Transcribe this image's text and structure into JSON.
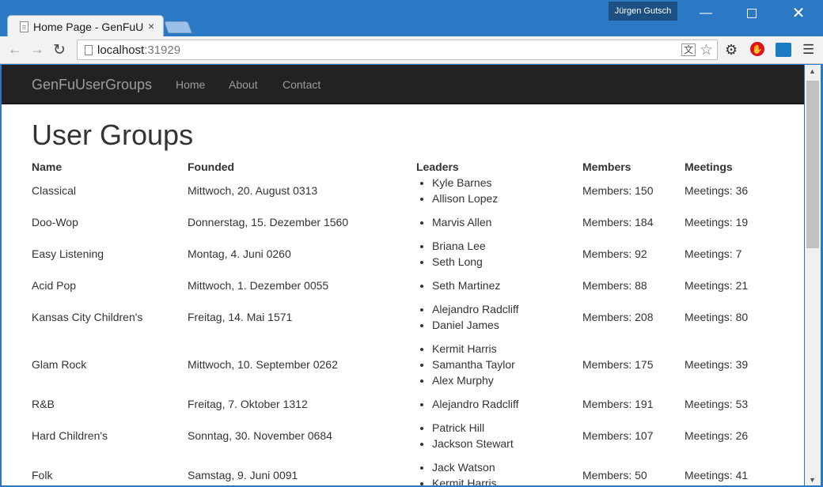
{
  "browser": {
    "tab_title": "Home Page - GenFuUserGroups",
    "tab_close": "×",
    "profile_name": "Jürgen Gutsch",
    "url_host": "localhost",
    "url_port": ":31929"
  },
  "navbar": {
    "brand": "GenFuUserGroups",
    "links": [
      "Home",
      "About",
      "Contact"
    ]
  },
  "page": {
    "title": "User Groups",
    "columns": [
      "Name",
      "Founded",
      "Leaders",
      "Members",
      "Meetings"
    ]
  },
  "rows": [
    {
      "name": "Classical",
      "founded": "Mittwoch, 20. August 0313",
      "leaders": [
        "Kyle Barnes",
        "Allison Lopez"
      ],
      "members": "Members: 150",
      "meetings": "Meetings: 36"
    },
    {
      "name": "Doo-Wop",
      "founded": "Donnerstag, 15. Dezember 1560",
      "leaders": [
        "Marvis Allen"
      ],
      "members": "Members: 184",
      "meetings": "Meetings: 19"
    },
    {
      "name": "Easy Listening",
      "founded": "Montag, 4. Juni 0260",
      "leaders": [
        "Briana Lee",
        "Seth Long"
      ],
      "members": "Members: 92",
      "meetings": "Meetings: 7"
    },
    {
      "name": "Acid Pop",
      "founded": "Mittwoch, 1. Dezember 0055",
      "leaders": [
        "Seth Martinez"
      ],
      "members": "Members: 88",
      "meetings": "Meetings: 21"
    },
    {
      "name": "Kansas City Children's",
      "founded": "Freitag, 14. Mai 1571",
      "leaders": [
        "Alejandro Radcliff",
        "Daniel James"
      ],
      "members": "Members: 208",
      "meetings": "Meetings: 80"
    },
    {
      "name": "Glam Rock",
      "founded": "Mittwoch, 10. September 0262",
      "leaders": [
        "Kermit Harris",
        "Samantha Taylor",
        "Alex Murphy"
      ],
      "members": "Members: 175",
      "meetings": "Meetings: 39"
    },
    {
      "name": "R&B",
      "founded": "Freitag, 7. Oktober 1312",
      "leaders": [
        "Alejandro Radcliff"
      ],
      "members": "Members: 191",
      "meetings": "Meetings: 53"
    },
    {
      "name": "Hard Children's",
      "founded": "Sonntag, 30. November 0684",
      "leaders": [
        "Patrick Hill",
        "Jackson Stewart"
      ],
      "members": "Members: 107",
      "meetings": "Meetings: 26"
    },
    {
      "name": "Folk",
      "founded": "Samstag, 9. Juni 0091",
      "leaders": [
        "Jack Watson",
        "Kermit Harris"
      ],
      "members": "Members: 50",
      "meetings": "Meetings: 41"
    }
  ]
}
